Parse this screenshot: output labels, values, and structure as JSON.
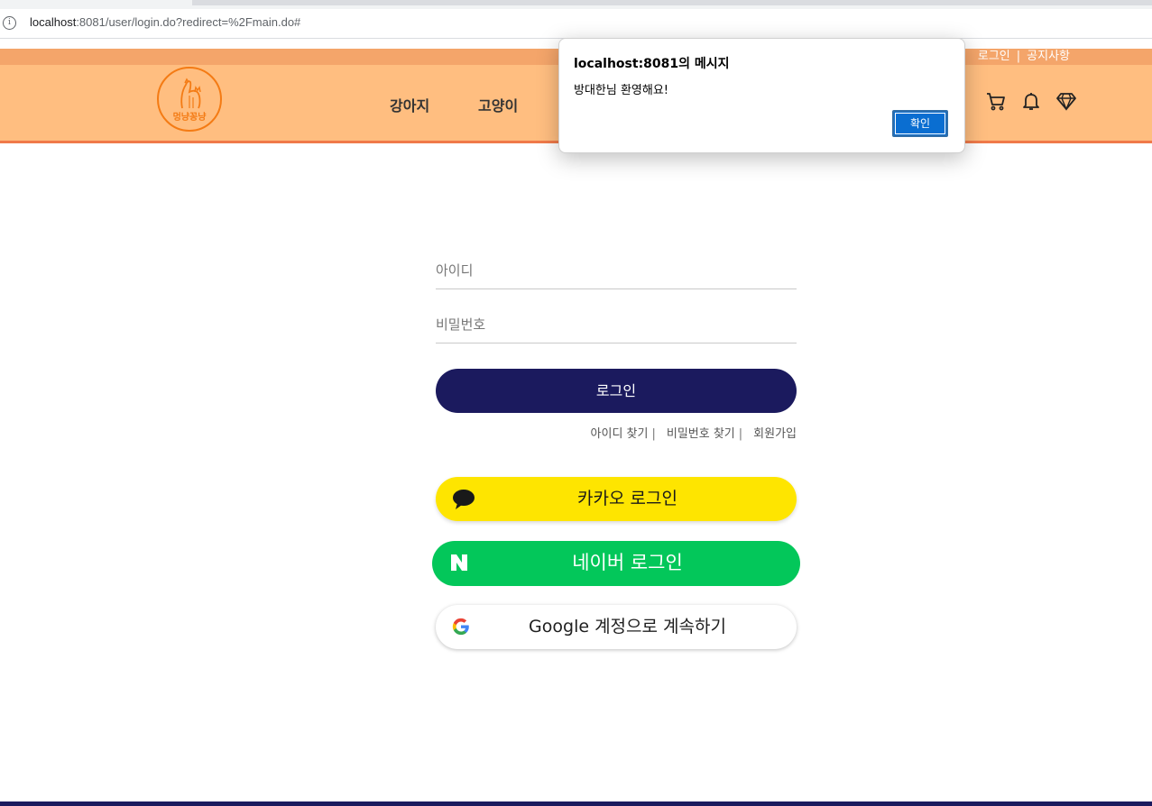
{
  "browser": {
    "url_host": "localhost",
    "url_rest": ":8081/user/login.do?redirect=%2Fmain.do#",
    "info_icon": "info-icon"
  },
  "header": {
    "util_links": [
      "로그인",
      "공지사항"
    ],
    "logo_text": "멍냥꽁냥",
    "nav": [
      "강아지",
      "고양이"
    ],
    "icons": [
      "cart-icon",
      "bell-icon",
      "diamond-icon"
    ],
    "colors": {
      "util_bar": "#f4a56a",
      "header_bg": "#ffbe80",
      "accent": "#f07a4a",
      "logo": "#f47b14"
    }
  },
  "login": {
    "id_placeholder": "아이디",
    "pw_placeholder": "비밀번호",
    "login_button": "로그인",
    "find_id": "아이디 찾기",
    "find_pw": "비밀번호 찾기",
    "separator": "|",
    "signup": "회원가입",
    "button_color": "#1b1a5e"
  },
  "social": {
    "kakao": {
      "label": "카카오 로그인",
      "color": "#fee500",
      "icon": "speech-bubble-icon"
    },
    "naver": {
      "label": "네이버 로그인",
      "color": "#03c75a",
      "icon": "naver-n-icon"
    },
    "google": {
      "label": "Google 계정으로 계속하기",
      "color": "#ffffff",
      "icon": "google-g-icon"
    }
  },
  "dialog": {
    "title": "localhost:8081의 메시지",
    "message": "방대한님 환영해요!",
    "ok_button": "확인"
  }
}
